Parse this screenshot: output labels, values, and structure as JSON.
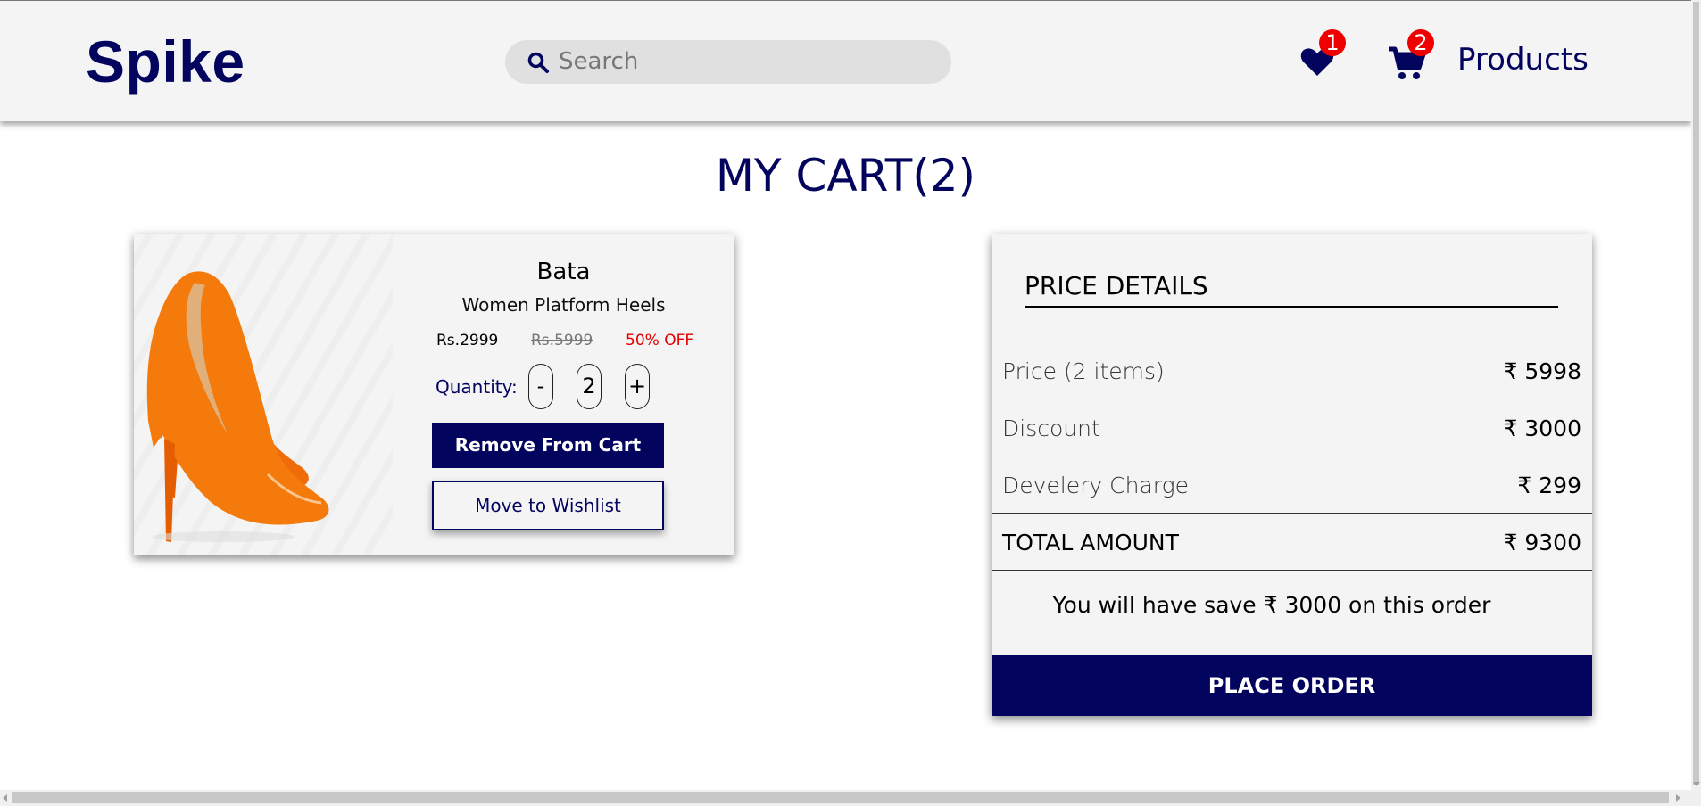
{
  "navbar": {
    "brand": "Spike",
    "search_placeholder": "Search",
    "wishlist_count": "1",
    "cart_count": "2",
    "products_link": "Products"
  },
  "page": {
    "title": "MY CART(2)"
  },
  "cart_item": {
    "brand": "Bata",
    "name": "Women Platform Heels",
    "price": "Rs.2999",
    "original_price": "Rs.5999",
    "discount": "50% OFF",
    "quantity_label": "Quantity:",
    "decrement": "-",
    "quantity": "2",
    "increment": "+",
    "remove_button": "Remove From Cart",
    "wishlist_button": "Move to Wishlist"
  },
  "price_details": {
    "heading": "PRICE DETAILS",
    "rows": [
      {
        "label": "Price (2 items)",
        "value": "₹ 5998"
      },
      {
        "label": "Discount",
        "value": "₹ 3000"
      },
      {
        "label": "Develery Charge",
        "value": "₹ 299"
      },
      {
        "label": "TOTAL AMOUNT",
        "value": "₹ 9300"
      }
    ],
    "savings_message": "You will have save ₹ 3000 on this order",
    "place_order": "PLACE ORDER"
  },
  "colors": {
    "primary": "#03045e",
    "badge": "#ee0000",
    "discount_text": "#e10000",
    "product_orange": "#f47a0c"
  },
  "icons": [
    "search-icon",
    "heart-icon",
    "cart-icon",
    "shoe-image"
  ]
}
